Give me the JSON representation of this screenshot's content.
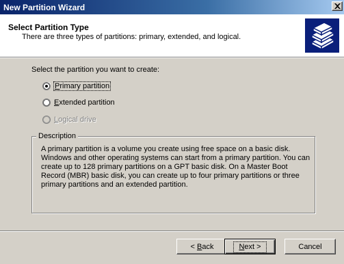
{
  "window": {
    "title": "New Partition Wizard"
  },
  "header": {
    "title": "Select Partition Type",
    "subtitle": "There are three types of partitions: primary, extended, and logical.",
    "icon": "partition-wizard-icon"
  },
  "main": {
    "prompt": "Select the partition you want to create:",
    "options": [
      {
        "label_pre": "",
        "mnemonic": "P",
        "label_post": "rimary partition",
        "selected": true,
        "enabled": true
      },
      {
        "label_pre": "",
        "mnemonic": "E",
        "label_post": "xtended partition",
        "selected": false,
        "enabled": true
      },
      {
        "label_pre": "",
        "mnemonic": "L",
        "label_post": "ogical drive",
        "selected": false,
        "enabled": false
      }
    ],
    "description": {
      "legend": "Description",
      "text": "A primary partition is a volume you create using free space on a basic disk. Windows and other operating systems can start from a primary partition. You can create up to 128 primary partitions on a GPT basic disk. On a Master Boot Record (MBR) basic disk, you can create up to four primary partitions or three primary partitions and an extended partition."
    }
  },
  "buttons": {
    "back_prefix": "< ",
    "back_mnemonic": "B",
    "back_rest": "ack",
    "next_mnemonic": "N",
    "next_rest": "ext >",
    "cancel": "Cancel"
  }
}
